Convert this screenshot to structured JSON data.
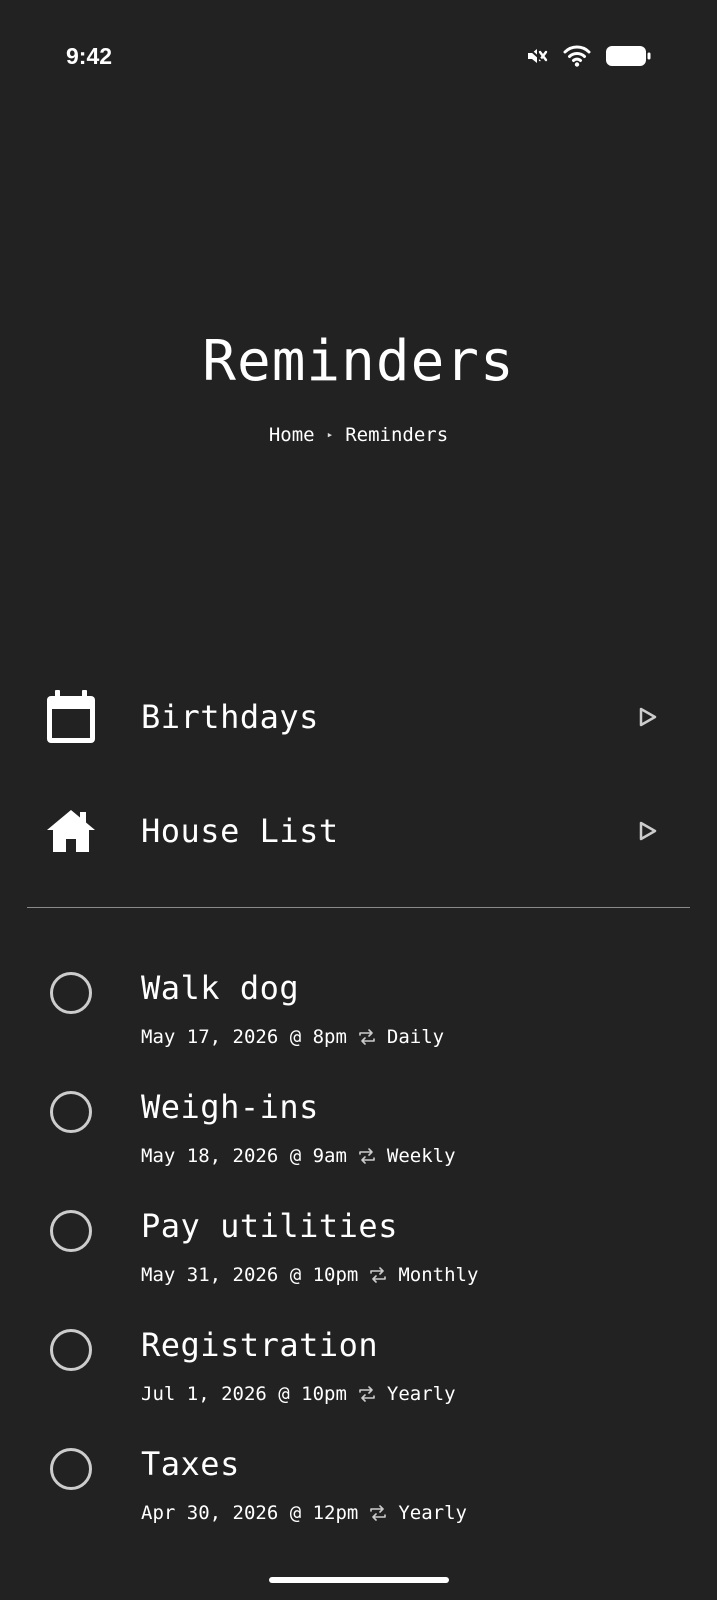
{
  "status_bar": {
    "time": "9:42",
    "icons": [
      "mute-icon",
      "wifi-icon",
      "battery-icon"
    ]
  },
  "header": {
    "title": "Reminders",
    "breadcrumb": {
      "home": "Home",
      "separator": "▸",
      "current": "Reminders"
    }
  },
  "categories": [
    {
      "label": "Birthdays",
      "icon": "calendar-icon"
    },
    {
      "label": "House List",
      "icon": "house-icon"
    }
  ],
  "reminders": [
    {
      "title": "Walk dog",
      "date": "May 17, 2026 @ 8pm",
      "repeat": "Daily"
    },
    {
      "title": "Weigh-ins",
      "date": "May 18, 2026 @ 9am",
      "repeat": "Weekly"
    },
    {
      "title": "Pay utilities",
      "date": "May 31, 2026 @ 10pm",
      "repeat": "Monthly"
    },
    {
      "title": "Registration",
      "date": "Jul 1, 2026 @ 10pm",
      "repeat": "Yearly"
    },
    {
      "title": "Taxes",
      "date": "Apr 30, 2026 @ 12pm",
      "repeat": "Yearly"
    }
  ],
  "colors": {
    "background": "#222222",
    "text": "#ffffff",
    "checkbox_border": "#cccccc",
    "divider": "#8a8a8a"
  }
}
